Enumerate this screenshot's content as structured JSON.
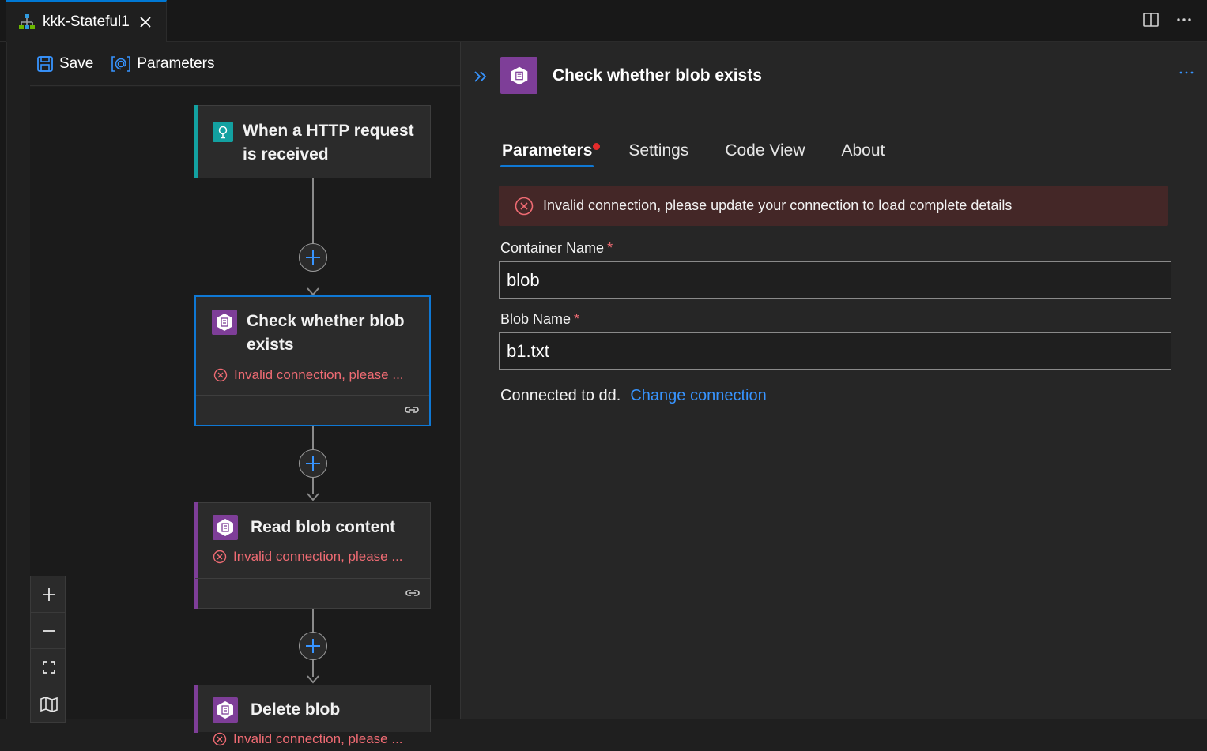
{
  "tab": {
    "title": "kkk-Stateful1"
  },
  "toolbar": {
    "save_label": "Save",
    "parameters_label": "Parameters"
  },
  "workflow": {
    "cards": [
      {
        "title_line1": "When a HTTP request",
        "title_line2": "is received"
      },
      {
        "title_line1": "Check whether blob",
        "title_line2": "exists",
        "error": "Invalid connection, please ..."
      },
      {
        "title_line1": "Read blob content",
        "error": "Invalid connection, please ..."
      },
      {
        "title_line1": "Delete blob",
        "error": "Invalid connection, please ..."
      }
    ]
  },
  "panel": {
    "title": "Check whether blob exists",
    "tabs": [
      "Parameters",
      "Settings",
      "Code View",
      "About"
    ],
    "error_message": "Invalid connection, please update your connection to load complete details",
    "fields": [
      {
        "label": "Container Name",
        "required_mark": "*",
        "value": "blob"
      },
      {
        "label": "Blob Name",
        "required_mark": "*",
        "value": "b1.txt"
      }
    ],
    "connected_text": "Connected to dd.",
    "change_connection_label": "Change connection"
  },
  "colors": {
    "accent_blue": "#0f78d4",
    "trigger_teal": "#13a1a1",
    "blob_purple": "#7e3e98",
    "error_red": "#ef6b73",
    "error_bg": "#442727"
  }
}
